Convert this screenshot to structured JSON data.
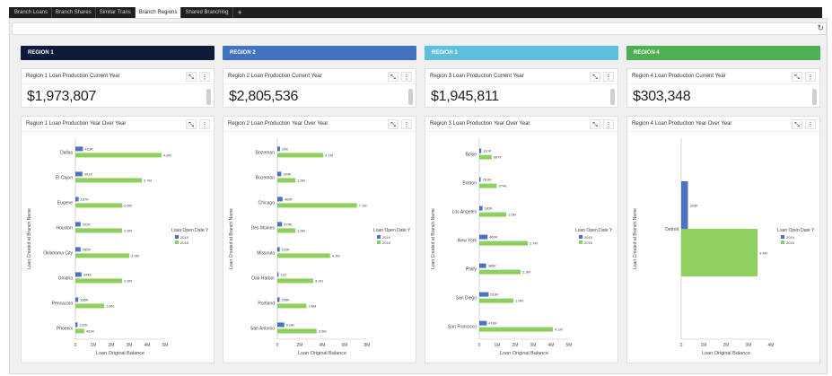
{
  "tabs": [
    {
      "label": "Branch Loans",
      "active": false
    },
    {
      "label": "Branch Shares",
      "active": false
    },
    {
      "label": "Similar Trans",
      "active": false
    },
    {
      "label": "Branch Regions",
      "active": true
    },
    {
      "label": "Shared Branching",
      "active": false
    }
  ],
  "add_tab_label": "+",
  "colors": {
    "series_2019": "#4a72c0",
    "series_2018": "#8fcf5e"
  },
  "regions": [
    {
      "header": "REGION 1",
      "color": "#0e1a3a",
      "kpi_title": "Region 1 Loan Production Current Year",
      "kpi_value": "$1,973,807",
      "chart_title": "Region 1 Loan Production Year Over Year"
    },
    {
      "header": "REGION 2",
      "color": "#4172c0",
      "kpi_title": "Region 2 Loan Production Current Year",
      "kpi_value": "$2,805,536",
      "chart_title": "Region 2 Loan Production Year Over Year"
    },
    {
      "header": "REGION 3",
      "color": "#5bc0de",
      "kpi_title": "Region 3 Loan Production Current Year",
      "kpi_value": "$1,945,811",
      "chart_title": "Region 3 Loan Production Year Over Year"
    },
    {
      "header": "REGION 4",
      "color": "#4caf50",
      "kpi_title": "Region 4 Loan Production Current Year",
      "kpi_value": "$303,348",
      "chart_title": "Region 4 Loan Production Year Over Year"
    }
  ],
  "chart_data": [
    {
      "type": "bar",
      "orientation": "horizontal",
      "categories": [
        "Dallas",
        "El Cajon",
        "Eugene",
        "Houston",
        "Oklahoma City",
        "Omaha",
        "Pensacola",
        "Phoenix"
      ],
      "series": [
        {
          "name": "2019",
          "values": [
            0.42,
            0.39,
            0.18,
            0.29,
            0.29,
            0.34,
            0.16,
            0.12
          ],
          "labels": [
            "423K",
            "391K",
            "187K",
            "295K",
            "285K",
            "344K",
            "165K",
            "122K"
          ]
        },
        {
          "name": "2018",
          "values": [
            4.8,
            3.7,
            2.6,
            2.6,
            3.0,
            2.6,
            1.6,
            0.49
          ],
          "labels": [
            "4.8M",
            "3.7M",
            "2.6M",
            "2.6M",
            "3.0M",
            "2.6M",
            "1.6M",
            "493K"
          ]
        }
      ],
      "xticks": [
        "0",
        "1M",
        "2M",
        "3M",
        "4M",
        "5M"
      ],
      "xlim": [
        0,
        5
      ],
      "xlabel": "Loan Original Balance",
      "ylabel": "Loan Created at Branch Name",
      "legend_title": "Loan Open Date Y",
      "legend": [
        "2019",
        "2018"
      ]
    },
    {
      "type": "bar",
      "orientation": "horizontal",
      "categories": [
        "Bozeman",
        "Bozeman",
        "Chicago",
        "Des Moines",
        "Missoula",
        "Oak Harbor",
        "Portland",
        "San Antonio"
      ],
      "series": [
        {
          "name": "2019",
          "values": [
            0.24,
            0.35,
            0.46,
            0.42,
            0.21,
            0.11,
            0.2,
            0.62
          ],
          "labels": [
            "24K",
            "353K",
            "466K",
            "424K",
            "210K",
            "11K",
            "206K",
            "619K"
          ]
        },
        {
          "name": "2018",
          "values": [
            4.1,
            1.6,
            7.1,
            1.6,
            4.7,
            3.2,
            2.6,
            3.5
          ],
          "labels": [
            "4.1M",
            "1.6M",
            "7.1M",
            "1.6M",
            "4.7M",
            "3.2M",
            "2.6M",
            "3.5M"
          ]
        }
      ],
      "xticks": [
        "0",
        "2M",
        "4M",
        "6M",
        "8M"
      ],
      "xlim": [
        0,
        8
      ],
      "xlabel": "Loan Original Balance",
      "ylabel": "Loan Created at Branch Name",
      "legend_title": "Loan Open Date Y",
      "legend": [
        "2019",
        "2018"
      ]
    },
    {
      "type": "bar",
      "orientation": "horizontal",
      "categories": [
        "Boise",
        "Boston",
        "Los Angeles",
        "New York",
        "Philly",
        "San Diego",
        "San Francisco"
      ],
      "series": [
        {
          "name": "2019",
          "values": [
            0.11,
            0.08,
            0.18,
            0.46,
            0.38,
            0.52,
            0.42
          ],
          "labels": [
            "110K",
            "76.6K",
            "183K",
            "460K",
            "385K",
            "518K",
            "416K"
          ]
        },
        {
          "name": "2018",
          "values": [
            0.69,
            0.97,
            1.5,
            2.7,
            2.3,
            1.9,
            4.1
          ],
          "labels": [
            "687K",
            "974K",
            "1.5M",
            "2.7M",
            "2.3M",
            "1.9M",
            "4.1M"
          ]
        }
      ],
      "xticks": [
        "0",
        "1M",
        "2M",
        "3M",
        "4M",
        "5M"
      ],
      "xlim": [
        0,
        5
      ],
      "xlabel": "Loan Original Balance",
      "ylabel": "Loan Created at Branch Name",
      "legend_title": "Loan Open Date Y",
      "legend": [
        "2019",
        "2018"
      ]
    },
    {
      "type": "bar",
      "orientation": "horizontal",
      "categories": [
        "Detroit"
      ],
      "series": [
        {
          "name": "2019",
          "values": [
            0.3
          ],
          "labels": [
            "303K"
          ]
        },
        {
          "name": "2018",
          "values": [
            3.4
          ],
          "labels": [
            "3.4M"
          ]
        }
      ],
      "xticks": [
        "0",
        "1M",
        "2M",
        "3M",
        "4M"
      ],
      "xlim": [
        0,
        4
      ],
      "xlabel": "Loan Original Balance",
      "ylabel": "Loan Created at Branch Name",
      "legend_title": "Loan Open Date Y",
      "legend": [
        "2019",
        "2018"
      ]
    }
  ]
}
